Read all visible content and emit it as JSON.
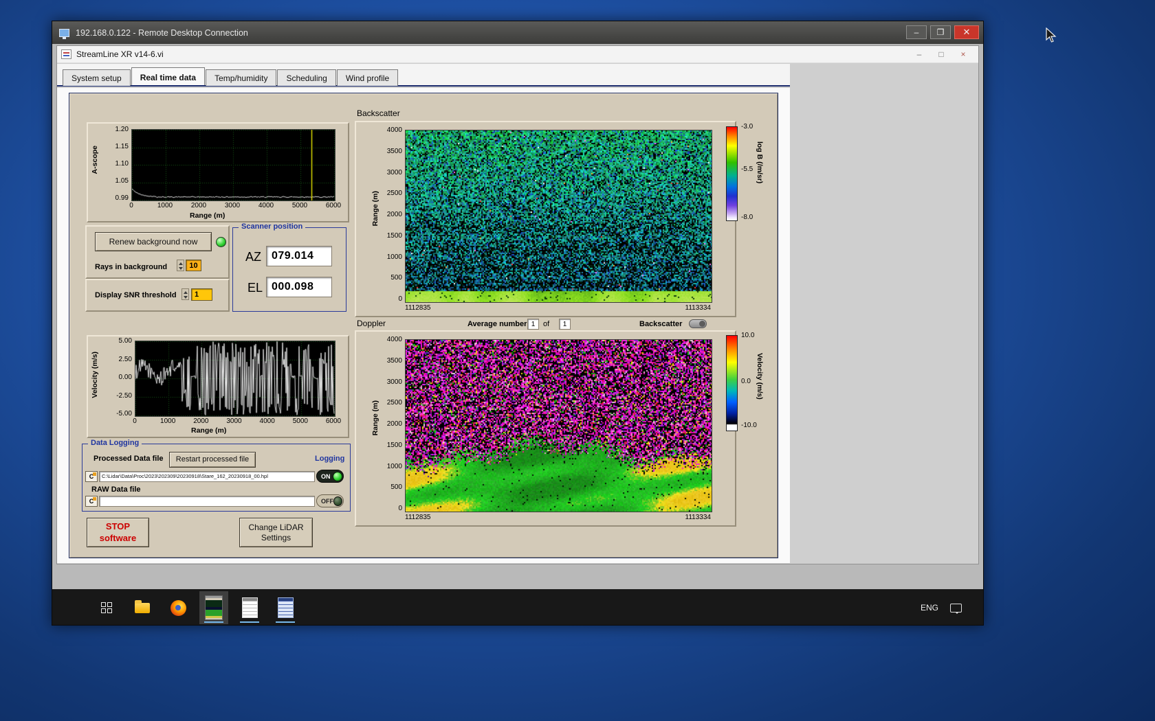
{
  "rdp": {
    "title": "192.168.0.122 - Remote Desktop Connection",
    "buttons": {
      "minimize": "–",
      "restore": "❐",
      "close": "✕"
    }
  },
  "app": {
    "title": "StreamLine XR v14-6.vi",
    "buttons": {
      "minimize": "–",
      "restore": "□",
      "close": "×"
    },
    "tabs": [
      "System setup",
      "Real time data",
      "Temp/humidity",
      "Scheduling",
      "Wind profile"
    ]
  },
  "ascope": {
    "ylabel": "A-scope",
    "xlabel": "Range (m)",
    "yticks": [
      "1.20",
      "1.15",
      "1.10",
      "1.05",
      "0.99"
    ],
    "xticks": [
      "0",
      "1000",
      "2000",
      "3000",
      "4000",
      "5000",
      "6000"
    ]
  },
  "controls": {
    "renew_button": "Renew background now",
    "rays_label": "Rays in background",
    "rays_value": "10",
    "snr_label": "Display SNR threshold",
    "snr_value": "1"
  },
  "scanner": {
    "title": "Scanner position",
    "az_label": "AZ",
    "az_value": "079.014",
    "el_label": "EL",
    "el_value": "000.098"
  },
  "velocity": {
    "ylabel": "Velocity (m/s)",
    "xlabel": "Range (m)",
    "yticks": [
      "5.00",
      "2.50",
      "0.00",
      "-2.50",
      "-5.00"
    ],
    "xticks": [
      "0",
      "1000",
      "2000",
      "3000",
      "4000",
      "5000",
      "6000"
    ]
  },
  "backscatter": {
    "title": "Backscatter",
    "ylabel": "Range (m)",
    "yticks": [
      "4000",
      "3500",
      "3000",
      "2500",
      "2000",
      "1500",
      "1000",
      "500",
      "0"
    ],
    "x_left": "1112835",
    "x_right": "1113334",
    "cb_label": "log B (/m/sr)",
    "cb_ticks": [
      "-3.0",
      "-5.5",
      "-8.0"
    ]
  },
  "doppler": {
    "title": "Doppler",
    "ylabel": "Range (m)",
    "avg_label": "Average number",
    "avg_value": "1",
    "of_label": "of",
    "avg_total": "1",
    "toggle_label": "Backscatter",
    "yticks": [
      "4000",
      "3500",
      "3000",
      "2500",
      "2000",
      "1500",
      "1000",
      "500",
      "0"
    ],
    "x_left": "1112835",
    "x_right": "1113334",
    "cb_label": "Velocity (m/s)",
    "cb_ticks": [
      "10.0",
      "0.0",
      "-10.0"
    ]
  },
  "logging": {
    "title": "Data Logging",
    "processed_label": "Processed Data file",
    "restart_button": "Restart processed file",
    "logging_label": "Logging",
    "drive": "C",
    "processed_path": "C:\\Lidar\\Data\\Proc\\2023\\202309\\20230918\\Stare_162_20230918_00.hpl",
    "raw_label": "RAW Data file",
    "raw_path": "",
    "on_label": "ON",
    "off_label": "OFF"
  },
  "footer": {
    "stop_line1": "STOP",
    "stop_line2": "software",
    "change_line1": "Change LiDAR",
    "change_line2": "Settings"
  },
  "taskbar": {
    "eng": "ENG"
  },
  "colors": {
    "panel_tan": "#d3cab8",
    "group_navy": "#1f35a0",
    "field_orange": "#fdb117",
    "field_yellow": "#ffc60a",
    "led_green": "#2fd42f",
    "stop_red": "#cc0000",
    "backscatter_gradient": [
      "#ff0000 0%",
      "#ff8800 10%",
      "#ffff00 20%",
      "#30c000 38%",
      "#00b090 52%",
      "#0070e0 64%",
      "#2030d0 74%",
      "#7040e0 84%",
      "#c0a0f0 92%",
      "#f0e8ff 97%",
      "#ffffff 100%"
    ],
    "doppler_gradient": [
      "#ff0000 0%",
      "#ff8800 14%",
      "#ffff00 28%",
      "#40d040 46%",
      "#00b8b8 58%",
      "#0060ff 70%",
      "#0020a0 82%",
      "#000428 90%",
      "#000000 93%",
      "#ffffff 94%",
      "#ffffff 100%"
    ]
  },
  "chart_data": [
    {
      "type": "line",
      "name": "a-scope",
      "xlabel": "Range (m)",
      "ylabel": "A-scope",
      "xlim": [
        0,
        6000
      ],
      "ylim": [
        0.99,
        1.2
      ],
      "description": "trace starts near 1.02 and settles to a flat noisy line near 1.00; yellow marker line at ~5400 m"
    },
    {
      "type": "heatmap",
      "name": "backscatter",
      "ylabel": "Range (m)",
      "ylim": [
        0,
        4000
      ],
      "x_range": [
        "1112835",
        "1113334"
      ],
      "colorbar": {
        "label": "log B (/m/sr)",
        "ticks": [
          -3.0,
          -5.5,
          -8.0
        ]
      },
      "description": "speckled green/teal attenuated backscatter, brighter green band near 0-300 m"
    },
    {
      "type": "line",
      "name": "velocity",
      "xlabel": "Range (m)",
      "ylabel": "Velocity (m/s)",
      "xlim": [
        0,
        6000
      ],
      "ylim": [
        -5,
        5
      ],
      "description": "coherent velocities below ~1400 m, saturated noise filling ±5 beyond"
    },
    {
      "type": "heatmap",
      "name": "doppler",
      "ylabel": "Range (m)",
      "ylim": [
        0,
        4000
      ],
      "x_range": [
        "1112835",
        "1113334"
      ],
      "colorbar": {
        "label": "Velocity (m/s)",
        "ticks": [
          10.0,
          0.0,
          -10.0
        ]
      },
      "description": "magenta/black noise aloft, smooth green/yellow velocities below ~1200 m"
    }
  ]
}
